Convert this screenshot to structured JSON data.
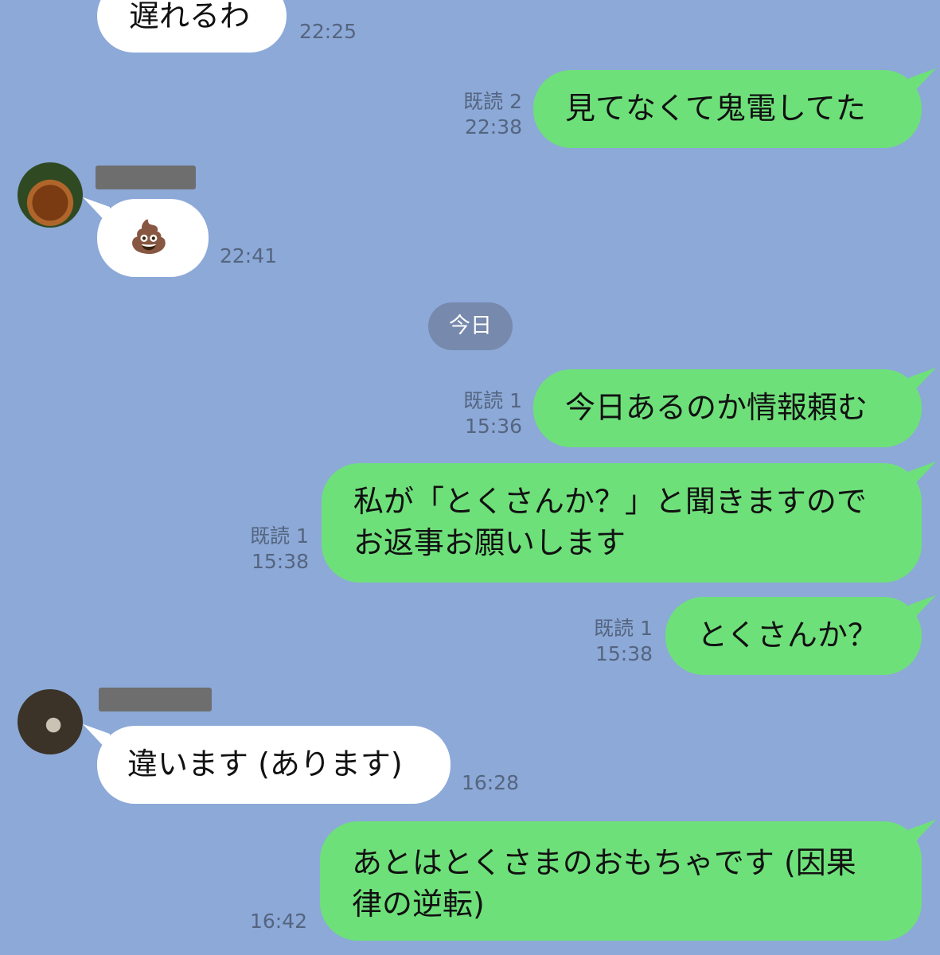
{
  "messages": [
    {
      "text": "遅れるわ",
      "time": "22:25"
    },
    {
      "text": "見てなくて鬼電してた",
      "read": "既読 2",
      "time": "22:38"
    },
    {
      "text": "💩",
      "time": "22:41"
    },
    {
      "text": "今日あるのか情報頼む",
      "read": "既読 1",
      "time": "15:36"
    },
    {
      "line1": "私が「とくさんか？」と聞きますので",
      "line2": "お返事お願いします",
      "read": "既読 1",
      "time": "15:38"
    },
    {
      "text": "とくさんか？",
      "read": "既読 1",
      "time": "15:38"
    },
    {
      "text": "違います (あります)",
      "time": "16:28"
    },
    {
      "line1": "あとはとくさまのおもちゃです (因果",
      "line2": "律の逆転)",
      "time": "16:42"
    }
  ],
  "date_separator": "今日"
}
